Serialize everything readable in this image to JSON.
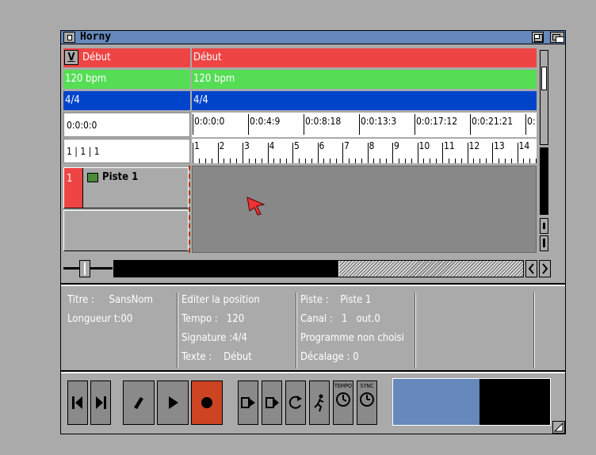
{
  "window": {
    "title": "Horny"
  },
  "info_rows": {
    "marker_toggle": "V",
    "marker_left": "Début",
    "marker_right": "Début",
    "tempo_left": "120 bpm",
    "tempo_right": "120 bpm",
    "signature_left": "4/4",
    "signature_right": "4/4",
    "time_position": "0:0:0:0",
    "bar_position": "1 | 1 | 1"
  },
  "timeline": {
    "times": [
      "0:0:0:0",
      "0:0:4:9",
      "0:0:8:18",
      "0:0:13:3",
      "0:0:17:12",
      "0:0:21:21",
      "0:"
    ],
    "bars": [
      "1",
      "2",
      "3",
      "4",
      "5",
      "6",
      "7",
      "8",
      "9",
      "10",
      "11",
      "12",
      "13",
      "14"
    ]
  },
  "tracks": [
    {
      "number": "1",
      "name": "Piste 1"
    }
  ],
  "info_panel": {
    "title_label": "Titre :",
    "title_value": "SansNom",
    "length": "Longueur t:00",
    "edit_position": "Editer la position",
    "tempo_label": "Tempo :",
    "tempo_value": "120",
    "signature_label": "Signature :",
    "signature_value": "4/4",
    "text_label": "Texte :",
    "text_value": "Début",
    "track_label": "Piste :",
    "track_value": "Piste 1",
    "channel_label": "Canal :",
    "channel_value": "1",
    "out_value": "out.0",
    "program": "Programme non choisi",
    "offset": "Décalage : 0"
  },
  "transport": {
    "tempo_button_label": "TEMPO",
    "sync_button_label": "SYNC",
    "level_fraction": 0.55
  },
  "colors": {
    "marker": "#ee4444",
    "tempo": "#55dd55",
    "signature": "#0044cc",
    "titlebar": "#6688bb"
  }
}
